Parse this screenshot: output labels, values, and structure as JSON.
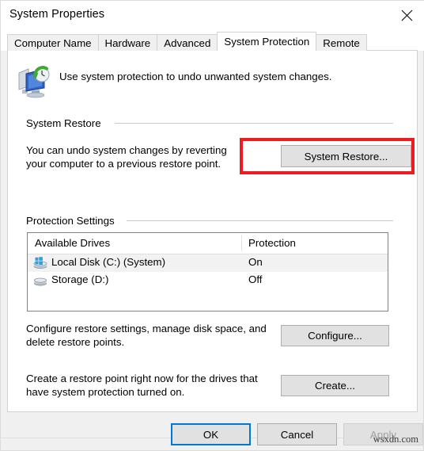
{
  "window": {
    "title": "System Properties",
    "close_icon": "close-icon"
  },
  "tabs": [
    {
      "label": "Computer Name",
      "active": false
    },
    {
      "label": "Hardware",
      "active": false
    },
    {
      "label": "Advanced",
      "active": false
    },
    {
      "label": "System Protection",
      "active": true
    },
    {
      "label": "Remote",
      "active": false
    }
  ],
  "header": {
    "icon": "system-restore-icon",
    "text": "Use system protection to undo unwanted system changes."
  },
  "system_restore": {
    "group_label": "System Restore",
    "description_line1": "You can undo system changes by reverting",
    "description_line2": "your computer to a previous restore point.",
    "button_label": "System Restore...",
    "highlight_color": "#ee1c20"
  },
  "protection_settings": {
    "group_label": "Protection Settings",
    "columns": [
      "Available Drives",
      "Protection"
    ],
    "rows": [
      {
        "icon": "system-drive-icon",
        "name": "Local Disk (C:) (System)",
        "protection": "On",
        "selected": true
      },
      {
        "icon": "drive-icon",
        "name": "Storage (D:)",
        "protection": "Off",
        "selected": false
      }
    ],
    "configure": {
      "description_line1": "Configure restore settings, manage disk space, and",
      "description_line2": "delete restore points.",
      "button_label": "Configure..."
    },
    "create": {
      "description_line1": "Create a restore point right now for the drives that",
      "description_line2": "have system protection turned on.",
      "button_label": "Create..."
    }
  },
  "footer": {
    "ok_label": "OK",
    "cancel_label": "Cancel",
    "apply_label": "Apply",
    "apply_disabled": true,
    "focus_color": "#0078d7"
  },
  "watermark": "wsxdn.com"
}
